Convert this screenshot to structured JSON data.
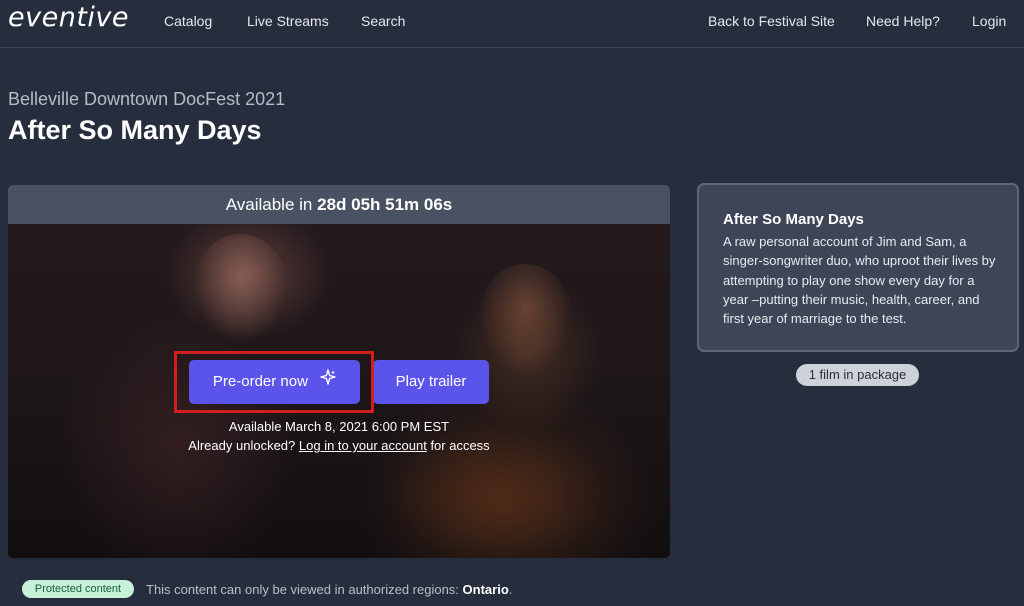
{
  "nav": {
    "logo": "eventive",
    "links": {
      "catalog": "Catalog",
      "live_streams": "Live Streams",
      "search": "Search",
      "back_to_festival": "Back to Festival Site",
      "need_help": "Need Help?",
      "login": "Login"
    }
  },
  "header": {
    "festival": "Belleville Downtown DocFest 2021",
    "title": "After So Many Days"
  },
  "player": {
    "countdown_prefix": "Available in",
    "countdown_time": "28d 05h 51m 06s",
    "preorder_label": "Pre-order now",
    "trailer_label": "Play trailer",
    "available_date": "Available March 8, 2021 6:00 PM EST",
    "unlocked_prefix": "Already unlocked?",
    "login_link": "Log in to your account",
    "unlocked_suffix": "for access",
    "icons": {
      "preorder": "sparkle-icon"
    }
  },
  "info": {
    "title": "After So Many Days",
    "description": "A raw personal account of Jim and Sam, a singer-songwriter duo, who uproot their lives by attempting to play one show every day for a year –putting their music, health, career, and first year of marriage to the test.",
    "package_count": "1 film in package"
  },
  "notice": {
    "badge": "Protected content",
    "text": "This content can only be viewed in authorized regions:",
    "region": "Ontario",
    "period": "."
  },
  "colors": {
    "background": "#262d3d",
    "accent_button": "#5a54ea",
    "highlight_border": "#d11f1f",
    "card_background": "#3d4557",
    "badge_background": "#c9f0d8",
    "badge_text": "#14633a"
  }
}
